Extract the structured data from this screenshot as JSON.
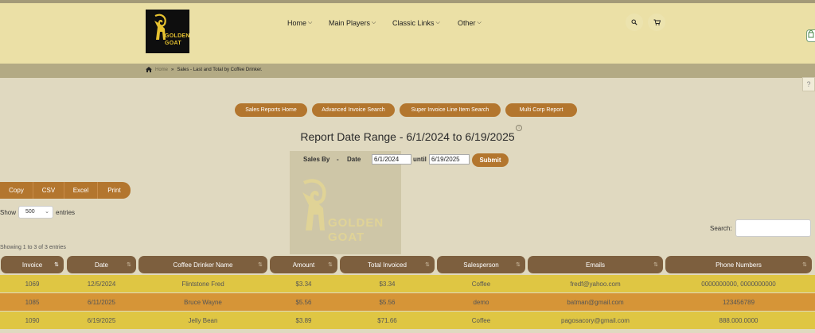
{
  "brand": {
    "logo_line1": "GOLDEN",
    "logo_line2": "GOAT"
  },
  "nav": [
    {
      "label": "Home"
    },
    {
      "label": "Main Players"
    },
    {
      "label": "Classic Links"
    },
    {
      "label": "Other"
    }
  ],
  "breadcrumb": {
    "home": "Home",
    "sep": "»",
    "current": "Sales - Last and Total by Coffee Drinker."
  },
  "report_buttons": [
    "Sales Reports Home",
    "Advanced Invoice Search",
    "Super Invoice Line Item Search",
    "Multi Corp Report"
  ],
  "report": {
    "title": "Report Date Range - 6/1/2024 to 6/19/2025"
  },
  "filter": {
    "sales_by": "Sales By",
    "dash": "-",
    "date_label": "Date",
    "from": "6/1/2024",
    "until": "until",
    "to": "6/19/2025",
    "submit": "Submit"
  },
  "watermark": {
    "line1": "GOLDEN",
    "line2": "GOAT"
  },
  "export_buttons": [
    "Copy",
    "CSV",
    "Excel",
    "Print"
  ],
  "length": {
    "show": "Show",
    "value": "500",
    "entries": "entries"
  },
  "search": {
    "label": "Search:",
    "value": ""
  },
  "info": "Showing 1 to 3 of 3 entries",
  "help": "?",
  "colors": {
    "header_bg": "#ebe0a6",
    "accent": "#b3762e",
    "table_header": "#7d5f3e",
    "row_odd": "#dfc643",
    "row_even": "#d69537"
  },
  "table": {
    "columns": [
      "Invoice",
      "Date",
      "Coffee Drinker Name",
      "Amount",
      "Total Invoiced",
      "Salesperson",
      "Emails",
      "Phone Numbers"
    ],
    "rows": [
      [
        "1069",
        "12/5/2024",
        "Flintstone Fred",
        "$3.34",
        "$3.34",
        "Coffee",
        "fredf@yahoo.com",
        "0000000000, 0000000000"
      ],
      [
        "1085",
        "6/11/2025",
        "Bruce Wayne",
        "$5.56",
        "$5.56",
        "demo",
        "batman@gmail.com",
        "123456789"
      ],
      [
        "1090",
        "6/19/2025",
        "Jelly Bean",
        "$3.89",
        "$71.66",
        "Coffee",
        "pagosacory@gmail.com",
        "888.000.0000"
      ]
    ]
  }
}
